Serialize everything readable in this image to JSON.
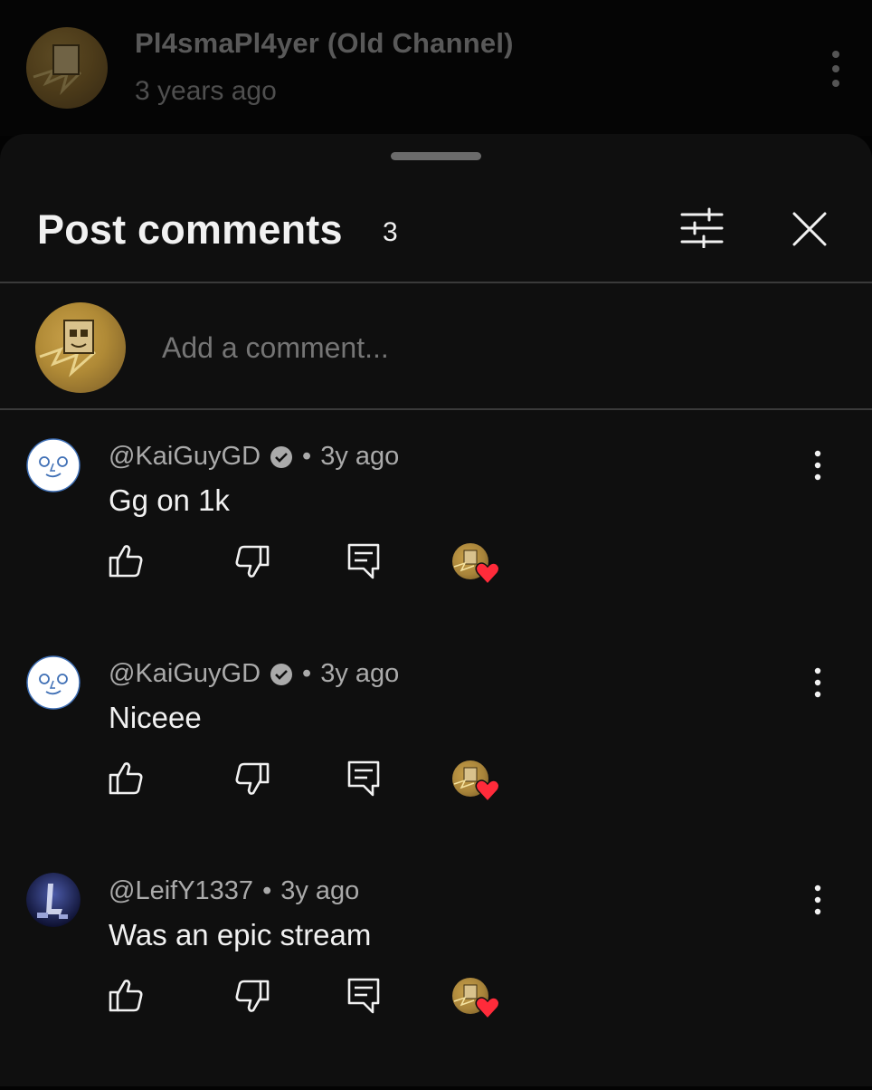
{
  "background": {
    "channel_name": "Pl4smaPl4yer (Old Channel)",
    "time": "3 years ago"
  },
  "panel": {
    "title": "Post comments",
    "count": "3",
    "add_comment_placeholder": "Add a comment..."
  },
  "comments": [
    {
      "author": "@KaiGuyGD",
      "verified": true,
      "time": "3y ago",
      "text": "Gg on 1k",
      "hearted": true
    },
    {
      "author": "@KaiGuyGD",
      "verified": true,
      "time": "3y ago",
      "text": "Niceee",
      "hearted": true
    },
    {
      "author": "@LeifY1337",
      "verified": false,
      "time": "3y ago",
      "text": "Was an epic stream",
      "hearted": true
    }
  ],
  "icons": {
    "header": [
      "more-vert-icon",
      "filter-icon",
      "close-icon"
    ],
    "comment_actions": [
      "thumb-up-icon",
      "thumb-down-icon",
      "reply-icon",
      "heart-icon"
    ]
  },
  "colors": {
    "sheet": "#0f0f0f",
    "text": "#f1f1f1",
    "secondary_text": "#aaaaaa",
    "heart": "#ff2b3a"
  }
}
